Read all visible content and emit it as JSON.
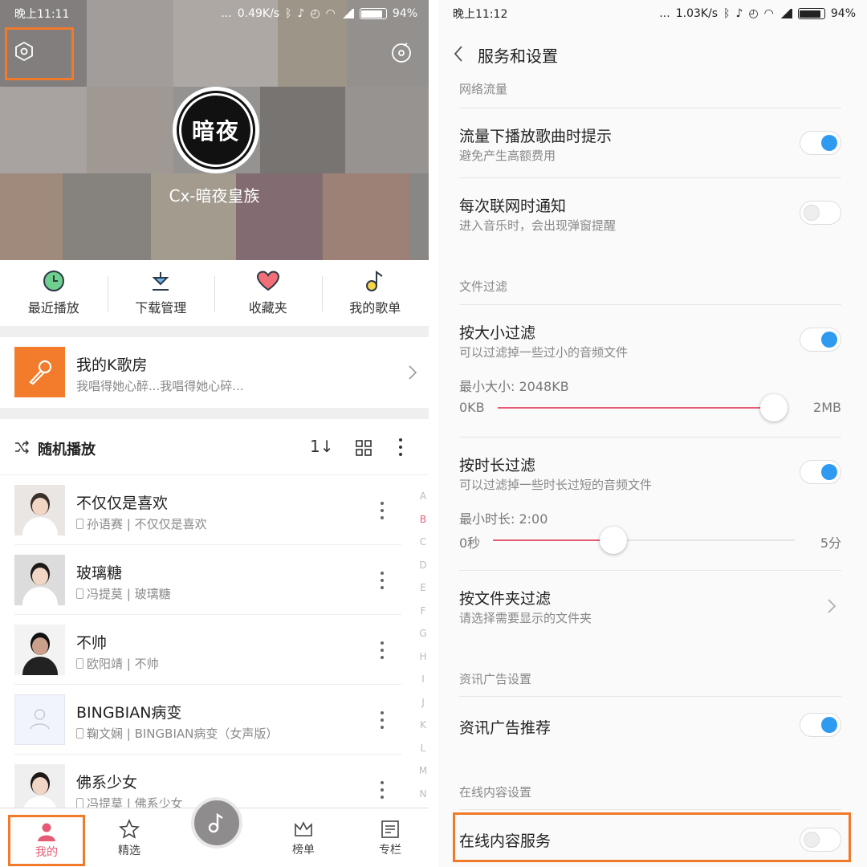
{
  "left": {
    "status": {
      "time": "晚上11:11",
      "dots": "...",
      "speed": "0.49K/s",
      "battery": "94%"
    },
    "profile": {
      "avatar_text": "暗夜",
      "username": "Cx-暗夜皇族"
    },
    "quick_actions": [
      {
        "label": "最近播放",
        "icon": "clock-icon"
      },
      {
        "label": "下载管理",
        "icon": "download-icon"
      },
      {
        "label": "收藏夹",
        "icon": "heart-icon"
      },
      {
        "label": "我的歌单",
        "icon": "music-note-icon"
      }
    ],
    "ksong": {
      "title": "我的K歌房",
      "subtitle": "我唱得她心醉...我唱得她心碎..."
    },
    "toolbar": {
      "shuffle_label": "随机播放",
      "sort_label": "1↓"
    },
    "songs": [
      {
        "title": "不仅仅是喜欢",
        "meta": "孙语赛 | 不仅仅是喜欢"
      },
      {
        "title": "玻璃糖",
        "meta": "冯提莫 | 玻璃糖"
      },
      {
        "title": "不帅",
        "meta": "欧阳靖 | 不帅"
      },
      {
        "title": "BINGBIAN病变",
        "meta": "鞠文娴 | BINGBIAN病变（女声版）"
      },
      {
        "title": "佛系少女",
        "meta": "冯提莫 | 佛系少女"
      }
    ],
    "alphabet": [
      "A",
      "B",
      "C",
      "D",
      "E",
      "F",
      "G",
      "H",
      "I",
      "J",
      "K",
      "L",
      "M",
      "N"
    ],
    "alphabet_active": "B",
    "bottom_nav": [
      {
        "label": "我的",
        "icon": "person-icon"
      },
      {
        "label": "精选",
        "icon": "star-icon"
      },
      {
        "label": "榜单",
        "icon": "crown-icon"
      },
      {
        "label": "专栏",
        "icon": "article-icon"
      }
    ],
    "colors": {
      "accent": "#e55b76",
      "highlight": "#f07a2a",
      "ksong": "#f27c2b"
    }
  },
  "right": {
    "status": {
      "time": "晚上11:12",
      "dots": "...",
      "speed": "1.03K/s",
      "battery": "94%"
    },
    "title": "服务和设置",
    "sections": {
      "network": "网络流量",
      "file_filter": "文件过滤",
      "ad": "资讯广告设置",
      "online": "在线内容设置"
    },
    "settings": {
      "traffic_prompt": {
        "title": "流量下播放歌曲时提示",
        "subtitle": "避免产生高额费用",
        "on": true
      },
      "connect_notify": {
        "title": "每次联网时通知",
        "subtitle": "进入音乐时，会出现弹窗提醒",
        "on": false
      },
      "size_filter": {
        "title": "按大小过滤",
        "subtitle": "可以过滤掉一些过小的音频文件",
        "on": true,
        "caption": "最小大小: 2048KB",
        "min_label": "0KB",
        "max_label": "2MB",
        "fraction": 1.0
      },
      "duration_filter": {
        "title": "按时长过滤",
        "subtitle": "可以过滤掉一些时长过短的音频文件",
        "on": true,
        "caption": "最小时长: 2:00",
        "min_label": "0秒",
        "max_label": "5分",
        "fraction": 0.4
      },
      "folder_filter": {
        "title": "按文件夹过滤",
        "subtitle": "请选择需要显示的文件夹"
      },
      "ad_recommend": {
        "title": "资讯广告推荐",
        "on": true
      },
      "online_service": {
        "title": "在线内容服务",
        "on": false
      }
    },
    "colors": {
      "toggle_on": "#2f9bf0",
      "slider_fill": "#e55b76"
    }
  }
}
